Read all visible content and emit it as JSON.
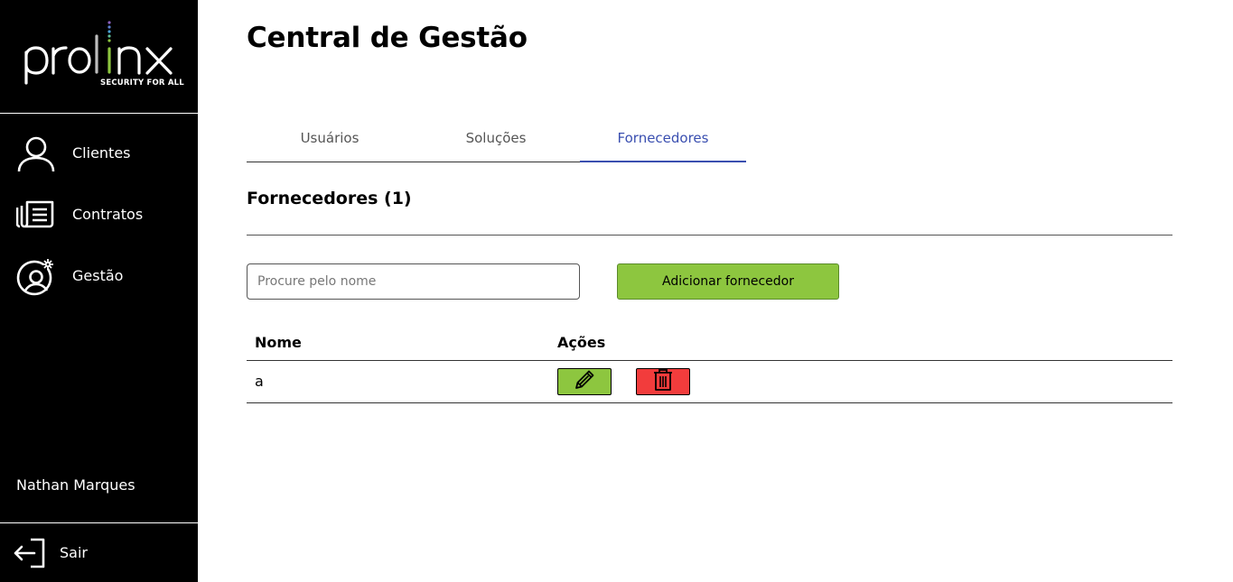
{
  "brand": {
    "logo_text": "prolinx",
    "tagline": "SECURITY FOR ALL"
  },
  "sidebar": {
    "items": [
      {
        "label": "Clientes",
        "icon": "user-icon"
      },
      {
        "label": "Contratos",
        "icon": "document-list-icon"
      },
      {
        "label": "Gestão",
        "icon": "user-gear-icon"
      }
    ],
    "user_name": "Nathan Marques",
    "logout_label": "Sair"
  },
  "page": {
    "title": "Central de Gestão"
  },
  "tabs": [
    {
      "label": "Usuários",
      "active": false
    },
    {
      "label": "Soluções",
      "active": false
    },
    {
      "label": "Fornecedores",
      "active": true
    }
  ],
  "section": {
    "title": "Fornecedores (1)"
  },
  "search": {
    "placeholder": "Procure pelo nome",
    "value": ""
  },
  "add_button_label": "Adicionar fornecedor",
  "table": {
    "headers": {
      "name": "Nome",
      "actions": "Ações"
    },
    "rows": [
      {
        "name": "a"
      }
    ]
  },
  "colors": {
    "sidebar_bg": "#000000",
    "accent_green": "#8dc63f",
    "danger_red": "#f23c3c",
    "active_tab": "#3a4fb0"
  }
}
